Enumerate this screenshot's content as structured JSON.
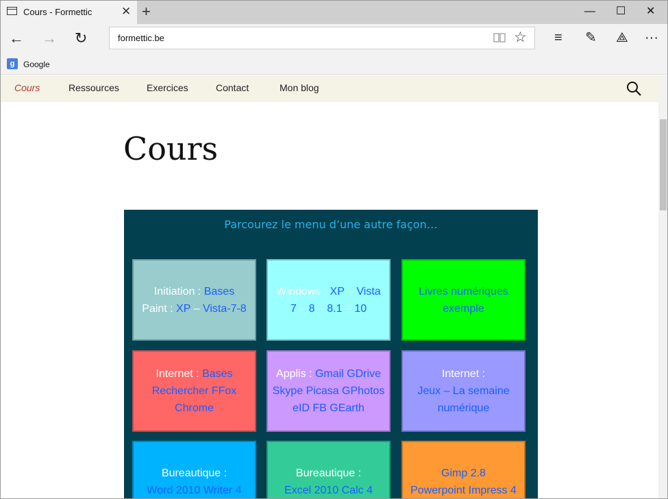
{
  "browser": {
    "tab_title": "Cours - Formettic",
    "tab_close": "✕",
    "new_tab": "+",
    "minimize": "—",
    "maximize": "☐",
    "close": "✕",
    "address": "formettic.be",
    "back": "←",
    "forward": "→",
    "refresh": "↻",
    "star": "☆",
    "hub": "≡",
    "note": "✎",
    "share": "⟁",
    "more": "···"
  },
  "favorites": [
    {
      "label": "Google",
      "icon": "g"
    }
  ],
  "site_nav": {
    "items": [
      "Cours",
      "Ressources",
      "Exercices",
      "Contact",
      "Mon blog"
    ],
    "active_index": 0
  },
  "page": {
    "title": "Cours",
    "panel_heading": "Parcourez le menu d’une autre façon…",
    "tiles": [
      {
        "bg": "#99cccc",
        "lines": [
          [
            [
              "w",
              "Initiation : "
            ],
            [
              "l",
              "Bases"
            ]
          ],
          [
            [
              "w",
              "Paint : "
            ],
            [
              "l",
              "XP"
            ],
            [
              "w",
              " – "
            ],
            [
              "l",
              "Vista-7-8"
            ]
          ]
        ]
      },
      {
        "bg": "#99ffff",
        "lines": [
          [
            [
              "w",
              "Windows : "
            ],
            [
              "l",
              "XP"
            ],
            [
              "w",
              " – "
            ],
            [
              "l",
              "Vista"
            ]
          ],
          [
            [
              "l",
              "7"
            ],
            [
              "w",
              " – "
            ],
            [
              "l",
              "8"
            ],
            [
              "w",
              " – "
            ],
            [
              "l",
              "8.1"
            ],
            [
              "w",
              " – "
            ],
            [
              "l",
              "10"
            ]
          ]
        ]
      },
      {
        "bg": "#00ff00",
        "lines": [
          [
            [
              "l",
              "Livres numériques"
            ]
          ],
          [
            [
              "l",
              "exemple"
            ]
          ]
        ]
      },
      {
        "bg": "#ff6666",
        "lines": [
          [
            [
              "w",
              "Internet : "
            ],
            [
              "l",
              "Bases"
            ]
          ],
          [
            [
              "l",
              "Rechercher FFox"
            ]
          ],
          [
            [
              "l",
              "Chrome"
            ]
          ]
        ]
      },
      {
        "bg": "#cc99ff",
        "lines": [
          [
            [
              "w",
              "Applis : "
            ],
            [
              "l",
              "Gmail GDrive"
            ]
          ],
          [
            [
              "l",
              "Skype Picasa GPhotos"
            ]
          ],
          [
            [
              "l",
              "eID FB GEarth"
            ]
          ]
        ]
      },
      {
        "bg": "#9999ff",
        "lines": [
          [
            [
              "w",
              "Internet :"
            ]
          ],
          [
            [
              "l",
              "Jeux – La semaine"
            ]
          ],
          [
            [
              "l",
              "numérique"
            ]
          ]
        ]
      },
      {
        "bg": "#00b3ff",
        "lines": [
          [
            [
              "w",
              "Bureautique :"
            ]
          ],
          [
            [
              "l",
              "Word 2010 Writer 4"
            ]
          ]
        ]
      },
      {
        "bg": "#33cc99",
        "lines": [
          [
            [
              "w",
              "Bureautique :"
            ]
          ],
          [
            [
              "l",
              "Excel 2010 Calc 4"
            ]
          ]
        ]
      },
      {
        "bg": "#ff9933",
        "lines": [
          [
            [
              "l",
              "Gimp 2.8"
            ]
          ],
          [
            [
              "l",
              "Powerpoint Impress 4"
            ]
          ]
        ]
      }
    ]
  }
}
